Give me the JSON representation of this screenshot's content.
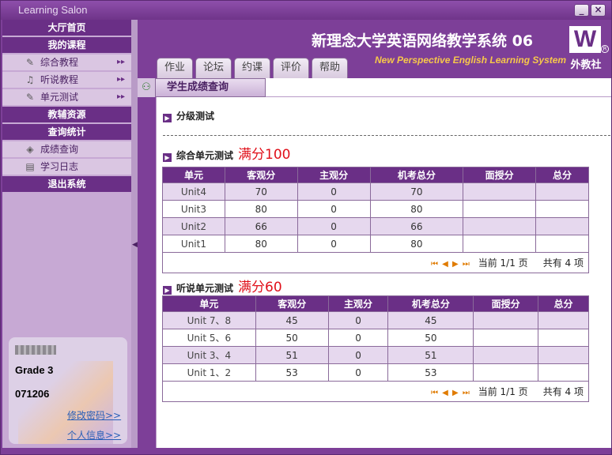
{
  "window": {
    "title": "Learning Salon",
    "min_label": "_",
    "close_label": "×"
  },
  "sidebar": {
    "items": [
      {
        "type": "head",
        "label": "大厅首页"
      },
      {
        "type": "head",
        "label": "我的课程"
      },
      {
        "type": "sub",
        "label": "综合教程",
        "icon": "pencil-icon",
        "arrow": "▸▸"
      },
      {
        "type": "sub",
        "label": "听说教程",
        "icon": "headset-icon",
        "arrow": "▸▸"
      },
      {
        "type": "sub",
        "label": "单元测试",
        "icon": "pencil-icon",
        "arrow": "▸▸"
      },
      {
        "type": "head",
        "label": "教辅资源"
      },
      {
        "type": "head",
        "label": "查询统计"
      },
      {
        "type": "sub",
        "label": "成绩查询",
        "icon": "cube-icon",
        "arrow": ""
      },
      {
        "type": "sub",
        "label": "学习日志",
        "icon": "document-icon",
        "arrow": ""
      },
      {
        "type": "head",
        "label": "退出系统"
      }
    ],
    "user": {
      "grade": "Grade 3",
      "id": "071206",
      "change_pwd": "修改密码>>",
      "profile": "个人信息>>"
    }
  },
  "header": {
    "title": "新理念大学英语网络教学系统 06",
    "subtitle": "New Perspective English Learning System",
    "logo_letter": "W",
    "logo_reg": "R",
    "logo_text": "外教社",
    "tabs": [
      "作业",
      "论坛",
      "约课",
      "评价",
      "帮助"
    ]
  },
  "breadcrumb": {
    "label": "学生成绩查询"
  },
  "content": {
    "section_grade_test": "分级测试",
    "section_comprehensive": {
      "title": "综合单元测试",
      "note": "满分100"
    },
    "section_listening": {
      "title": "听说单元测试",
      "note": "满分60"
    },
    "columns": [
      "单元",
      "客观分",
      "主观分",
      "机考总分",
      "面授分",
      "总分"
    ],
    "comprehensive_rows": [
      [
        "Unit4",
        "70",
        "0",
        "70",
        "",
        ""
      ],
      [
        "Unit3",
        "80",
        "0",
        "80",
        "",
        ""
      ],
      [
        "Unit2",
        "66",
        "0",
        "66",
        "",
        ""
      ],
      [
        "Unit1",
        "80",
        "0",
        "80",
        "",
        ""
      ]
    ],
    "listening_rows": [
      [
        "Unit 7、8",
        "45",
        "0",
        "45",
        "",
        ""
      ],
      [
        "Unit 5、6",
        "50",
        "0",
        "50",
        "",
        ""
      ],
      [
        "Unit 3、4",
        "51",
        "0",
        "51",
        "",
        ""
      ],
      [
        "Unit 1、2",
        "53",
        "0",
        "53",
        "",
        ""
      ]
    ],
    "pager": {
      "controls": "⏮ ◀ ▶ ⏭",
      "current": "当前 1/1 页",
      "total": "共有 4 项"
    }
  },
  "colors": {
    "brand_purple": "#6a2f86",
    "accent_yellow": "#f7c84a",
    "note_red": "#e0101a"
  }
}
